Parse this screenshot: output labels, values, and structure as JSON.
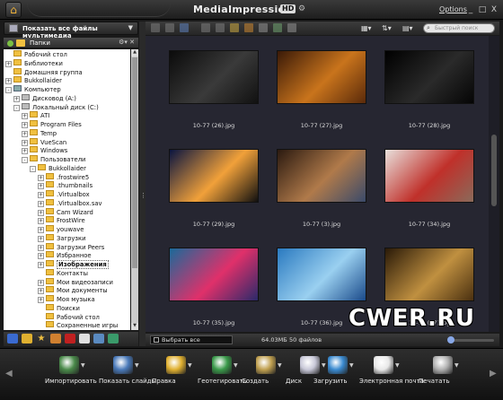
{
  "window": {
    "title": "MediaImpression",
    "badge": "HD",
    "options_label": "Options",
    "minimize": "_",
    "maximize": "□",
    "close": "X"
  },
  "left_panel": {
    "show_all_label": "Показать все файлы мультимедиа",
    "folders_label": "Папки",
    "tree": [
      {
        "label": "Рабочий стол",
        "level": 0,
        "exp": "",
        "icon": "desktop"
      },
      {
        "label": "Библиотеки",
        "level": 0,
        "exp": "+",
        "icon": "folder"
      },
      {
        "label": "Домашняя группа",
        "level": 0,
        "exp": "",
        "icon": "folder"
      },
      {
        "label": "Bukkollaider",
        "level": 0,
        "exp": "+",
        "icon": "folder"
      },
      {
        "label": "Компьютер",
        "level": 0,
        "exp": "-",
        "icon": "pc"
      },
      {
        "label": "Дисковод (A:)",
        "level": 1,
        "exp": "+",
        "icon": "drive"
      },
      {
        "label": "Локальный диск (C:)",
        "level": 1,
        "exp": "-",
        "icon": "drive"
      },
      {
        "label": "ATI",
        "level": 2,
        "exp": "+",
        "icon": "folder"
      },
      {
        "label": "Program Files",
        "level": 2,
        "exp": "+",
        "icon": "folder"
      },
      {
        "label": "Temp",
        "level": 2,
        "exp": "+",
        "icon": "folder"
      },
      {
        "label": "VueScan",
        "level": 2,
        "exp": "+",
        "icon": "folder"
      },
      {
        "label": "Windows",
        "level": 2,
        "exp": "+",
        "icon": "folder"
      },
      {
        "label": "Пользователи",
        "level": 2,
        "exp": "-",
        "icon": "folder"
      },
      {
        "label": "Bukkollaider",
        "level": 3,
        "exp": "-",
        "icon": "folder"
      },
      {
        "label": ".frostwire5",
        "level": 4,
        "exp": "+",
        "icon": "folder"
      },
      {
        "label": ".thumbnails",
        "level": 4,
        "exp": "+",
        "icon": "folder"
      },
      {
        "label": ".Virtualbox",
        "level": 4,
        "exp": "+",
        "icon": "folder"
      },
      {
        "label": ".Virtualbox.sav",
        "level": 4,
        "exp": "+",
        "icon": "folder"
      },
      {
        "label": "Cam Wizard",
        "level": 4,
        "exp": "+",
        "icon": "folder"
      },
      {
        "label": "FrostWire",
        "level": 4,
        "exp": "+",
        "icon": "folder"
      },
      {
        "label": "youwave",
        "level": 4,
        "exp": "+",
        "icon": "folder"
      },
      {
        "label": "Загрузки",
        "level": 4,
        "exp": "+",
        "icon": "folder"
      },
      {
        "label": "Загрузки Peers",
        "level": 4,
        "exp": "+",
        "icon": "folder"
      },
      {
        "label": "Избранное",
        "level": 4,
        "exp": "+",
        "icon": "folder"
      },
      {
        "label": "Изображения",
        "level": 4,
        "exp": "+",
        "icon": "folder",
        "selected": true
      },
      {
        "label": "Контакты",
        "level": 4,
        "exp": "",
        "icon": "folder"
      },
      {
        "label": "Мои видеозаписи",
        "level": 4,
        "exp": "+",
        "icon": "folder"
      },
      {
        "label": "Мои документы",
        "level": 4,
        "exp": "+",
        "icon": "folder"
      },
      {
        "label": "Моя музыка",
        "level": 4,
        "exp": "+",
        "icon": "folder"
      },
      {
        "label": "Поиски",
        "level": 4,
        "exp": "",
        "icon": "folder"
      },
      {
        "label": "Рабочий стол",
        "level": 4,
        "exp": "",
        "icon": "folder"
      },
      {
        "label": "Сохраненные игры",
        "level": 4,
        "exp": "",
        "icon": "folder"
      }
    ]
  },
  "search": {
    "placeholder": "Быстрый поиск"
  },
  "gallery": [
    {
      "caption": "10-77 (26).jpg",
      "colors": [
        "#0b0b0b",
        "#3a3a3a",
        "#111"
      ]
    },
    {
      "caption": "10-77 (27).jpg",
      "colors": [
        "#3a1a08",
        "#c9741c",
        "#5a2a0a"
      ]
    },
    {
      "caption": "10-77 (28).jpg",
      "colors": [
        "#000000",
        "#2a2a2a",
        "#050505"
      ]
    },
    {
      "caption": "10-77 (29).jpg",
      "colors": [
        "#0a1540",
        "#f1a13a",
        "#101010"
      ]
    },
    {
      "caption": "10-77 (3).jpg",
      "colors": [
        "#2b1a10",
        "#b07a4a",
        "#3a4a6a"
      ]
    },
    {
      "caption": "10-77 (34).jpg",
      "colors": [
        "#e8e0dc",
        "#c0302a",
        "#8a6a5a"
      ]
    },
    {
      "caption": "10-77 (35).jpg",
      "colors": [
        "#1a6a9a",
        "#e0306a",
        "#2a2a6a"
      ]
    },
    {
      "caption": "10-77 (36).jpg",
      "colors": [
        "#2a7ac0",
        "#9ad0f0",
        "#1a4a8a"
      ]
    },
    {
      "caption": "10-77 (37).jpg",
      "colors": [
        "#2a1a08",
        "#c09040",
        "#4a3010"
      ]
    }
  ],
  "statusbar": {
    "select_all": "Выбрать все",
    "size": "64.03МБ",
    "count": "50 файлов"
  },
  "watermark": "CWER.RU",
  "actions": [
    {
      "label": "Импортировать",
      "icon": "import-icon",
      "color": "#4a8a4a"
    },
    {
      "label": "Показать слайды",
      "icon": "slideshow-icon",
      "color": "#4a7aba"
    },
    {
      "label": "Правка",
      "icon": "edit-pencil-icon",
      "color": "#e0b030"
    },
    {
      "label": "Геотегировать",
      "icon": "geotag-icon",
      "color": "#3a9a4a"
    },
    {
      "label": "Создать",
      "icon": "create-icon",
      "color": "#c0a050"
    },
    {
      "label": "Диск",
      "icon": "disc-icon",
      "color": "#c8c8d8"
    },
    {
      "label": "Загрузить",
      "icon": "upload-icon",
      "color": "#3a8ad0"
    },
    {
      "label": "Электронная почта",
      "icon": "email-icon",
      "color": "#e8e8e8"
    },
    {
      "label": "Печатать",
      "icon": "print-icon",
      "color": "#b0b0b0"
    }
  ]
}
